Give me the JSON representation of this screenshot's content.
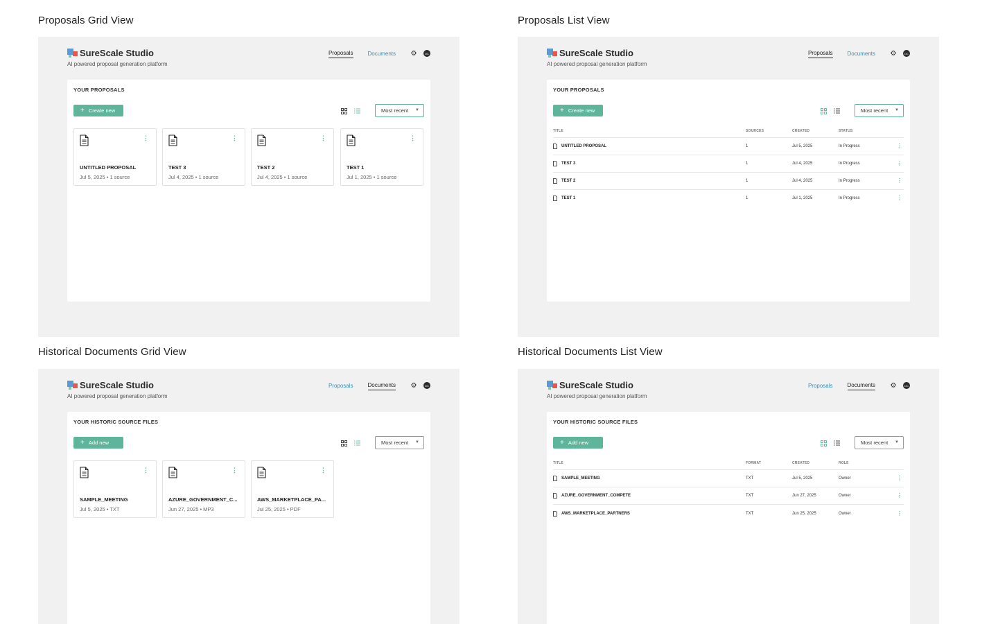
{
  "app": {
    "name": "SureScale Studio",
    "tagline": "AI powered proposal generation platform",
    "nav": {
      "proposals": "Proposals",
      "documents": "Documents"
    },
    "avatar_initials": "DC",
    "colors": {
      "accent": "#5fb59a",
      "link": "#3a8fb0"
    }
  },
  "common": {
    "sort_label": "Most recent"
  },
  "views": {
    "proposals_grid": {
      "heading": "Proposals Grid View",
      "panel_title": "YOUR PROPOSALS",
      "action_label": "Create new",
      "items": [
        {
          "title": "UNTITLED PROPOSAL",
          "meta": "Jul 5, 2025 • 1 source"
        },
        {
          "title": "TEST 3",
          "meta": "Jul 4, 2025 • 1 source"
        },
        {
          "title": "TEST 2",
          "meta": "Jul 4, 2025 • 1 source"
        },
        {
          "title": "TEST 1",
          "meta": "Jul 1, 2025 • 1 source"
        }
      ]
    },
    "proposals_list": {
      "heading": "Proposals List View",
      "panel_title": "YOUR PROPOSALS",
      "action_label": "Create new",
      "columns": {
        "title": "TITLE",
        "c2": "SOURCES",
        "c3": "CREATED",
        "c4": "STATUS"
      },
      "rows": [
        {
          "title": "UNTITLED PROPOSAL",
          "c2": "1",
          "c3": "Jul 5, 2025",
          "c4": "In Progress"
        },
        {
          "title": "TEST 3",
          "c2": "1",
          "c3": "Jul 4, 2025",
          "c4": "In Progress"
        },
        {
          "title": "TEST 2",
          "c2": "1",
          "c3": "Jul 4, 2025",
          "c4": "In Progress"
        },
        {
          "title": "TEST 1",
          "c2": "1",
          "c3": "Jul 1, 2025",
          "c4": "In Progress"
        }
      ]
    },
    "documents_grid": {
      "heading": "Historical Documents Grid View",
      "panel_title": "YOUR HISTORIC SOURCE FILES",
      "action_label": "Add new",
      "items": [
        {
          "title": "SAMPLE_MEETING",
          "meta": "Jul 5, 2025 • TXT"
        },
        {
          "title": "AZURE_GOVERNMENT_C...",
          "meta": "Jun 27, 2025 • MP3"
        },
        {
          "title": "AWS_MARKETPLACE_PA...",
          "meta": "Jul 25, 2025 • PDF"
        }
      ]
    },
    "documents_list": {
      "heading": "Historical Documents List View",
      "panel_title": "YOUR HISTORIC SOURCE FILES",
      "action_label": "Add new",
      "columns": {
        "title": "TITLE",
        "c2": "FORMAT",
        "c3": "CREATED",
        "c4": "ROLE"
      },
      "rows": [
        {
          "title": "SAMPLE_MEETING",
          "c2": "TXT",
          "c3": "Jul 5, 2025",
          "c4": "Owner"
        },
        {
          "title": "AZURE_GOVERNMENT_COMPETE",
          "c2": "TXT",
          "c3": "Jun 27, 2025",
          "c4": "Owner"
        },
        {
          "title": "AWS_MARKETPLACE_PARTNERS",
          "c2": "TXT",
          "c3": "Jun 25, 2025",
          "c4": "Owner"
        }
      ]
    }
  }
}
